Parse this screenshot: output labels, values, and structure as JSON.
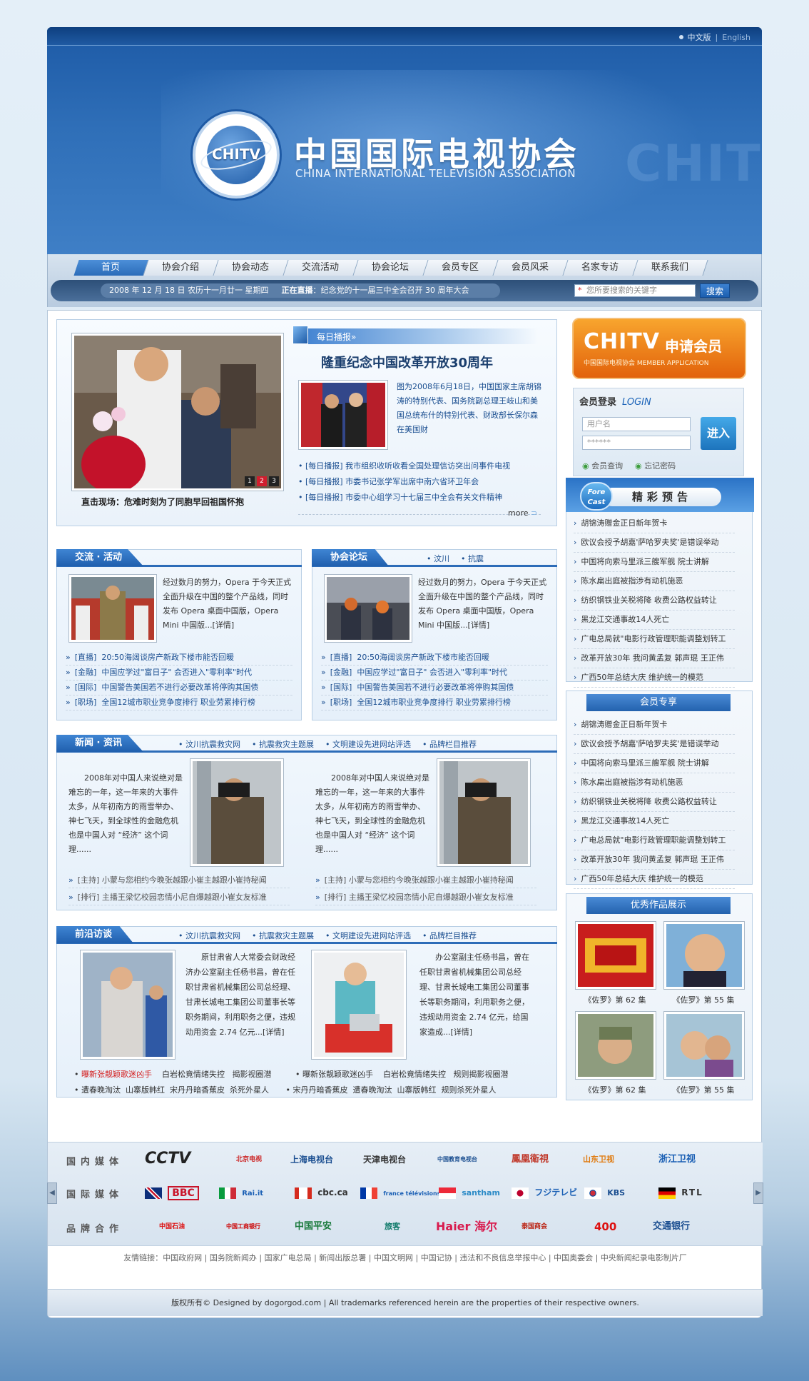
{
  "lang": {
    "cn": "中文版",
    "sep": "|",
    "en": "English"
  },
  "header": {
    "logo_text": "CHITV",
    "title_cn": "中国国际电视协会",
    "title_en": "CHINA INTERNATIONAL TELEVISION ASSOCIATION"
  },
  "nav": [
    "首页",
    "协会介绍",
    "协会动态",
    "交流活动",
    "协会论坛",
    "会员专区",
    "会员风采",
    "名家专访",
    "联系我们"
  ],
  "datebar": {
    "date": "2008 年 12 月 18 日   农历十一月廿一   星期四",
    "live_label": "正在直播",
    "live_text": "：纪念党的十一届三中全会召开 30 周年大会"
  },
  "search": {
    "placeholder": "您所要搜索的关键字",
    "button": "搜索"
  },
  "featured": {
    "photo_caption": "直击现场：危难时刻为了同胞早回祖国怀抱",
    "pager": [
      "1",
      "2",
      "3"
    ],
    "tab": "每日播报»",
    "headline": "隆重纪念中国改革开放30周年",
    "desc": "图为2008年6月18日，中国国家主席胡锦涛的特别代表、国务院副总理王岐山和美国总统布什的特别代表、财政部长保尔森在美国财",
    "links": [
      "[每日播报] 我市组织收听收看全国处理信访突出问事件电视",
      "[每日播报] 市委书记张学军出席中南六省环卫年会",
      "[每日播报] 市委中心组学习十七届三中全会有关文件精神"
    ],
    "more": "more"
  },
  "activities": {
    "title": "交流 · 活动",
    "text": "经过数月的努力，Opera 于今天正式全面升级在中国的整个产品线，同时发布 Opera 桌面中国版，Opera Mini 中国版...[详情]",
    "items": [
      {
        "tag": "[直播]",
        "text": "20:50海阔谈房产新政下楼市能否回暖"
      },
      {
        "tag": "[金融]",
        "text": "中国应学过\"富日子\" 会否进入\"零利率\"时代"
      },
      {
        "tag": "[国际]",
        "text": "中国警告美国若不进行必要改革将停购其国债"
      },
      {
        "tag": "[职场]",
        "text": "全国12城市职业竞争度排行 职业劳累排行榜"
      }
    ]
  },
  "forum": {
    "title": "协会论坛",
    "links": [
      "汶川",
      "抗震"
    ],
    "text": "经过数月的努力，Opera 于今天正式全面升级在中国的整个产品线，同时发布 Opera 桌面中国版，Opera Mini 中国版...[详情]",
    "items": [
      {
        "tag": "[直播]",
        "text": "20:50海阔谈房产新政下楼市能否回暖"
      },
      {
        "tag": "[金融]",
        "text": "中国应学过\"富日子\" 会否进入\"零利率\"时代"
      },
      {
        "tag": "[国际]",
        "text": "中国警告美国若不进行必要改革将停购其国债"
      },
      {
        "tag": "[职场]",
        "text": "全国12城市职业竞争度排行 职业劳累排行榜"
      }
    ]
  },
  "news": {
    "title": "新闻 · 资讯",
    "links": [
      "汶川抗震救灾网",
      "抗震救灾主题展",
      "文明建设先进网站评选",
      "品牌栏目推荐"
    ],
    "text": "2008年对中国人来说绝对是难忘的一年，这一年来的大事件太多，从年初南方的雨雪举办、神七飞天，到全球性的金融危机也是中国人对 “经济” 这个词理......",
    "items": [
      "[主持] 小蒙与您相约今晚张越跟小崔主越跟小崔持秘闻",
      "[排行] 主播王梁忆校园恋情小尼自爆越跟小崔女友标准"
    ]
  },
  "frontier": {
    "title": "前沿访谈",
    "links": [
      "汶川抗震救灾网",
      "抗震救灾主题展",
      "文明建设先进网站评选",
      "品牌栏目推荐"
    ],
    "text1": "原甘肃省人大常委会财政经济办公室副主任杨书昌，曾在任职甘肃省机械集团公司总经理、甘肃长城电工集团公司董事长等职务期间，利用职务之便，违规动用资金 2.74 亿元...[详情]",
    "text2": "办公室副主任杨书昌，曾在任职甘肃省机械集团公司总经理、甘肃长城电工集团公司董事长等职务期间，利用职务之便，违规动用资金 2.74 亿元，给国家造成...[详情]",
    "hot": [
      "曝新张靓颖歌迷凶手",
      "白岩松竟情绪失控",
      "揭影视圈潜",
      "曝新张靓颖歌迷凶手",
      "白岩松竟情绪失控",
      "规则揭影视圈潜"
    ],
    "hot2": [
      "遭春晚淘汰",
      "山寨版韩红",
      "宋丹丹暗香蕉皮",
      "杀死外星人",
      "宋丹丹暗香蕉皮",
      "遭春晚淘汰",
      "山寨版韩红",
      "规则杀死外星人"
    ]
  },
  "member_banner": {
    "big": "CHITV",
    "cn": "申请会员",
    "sub": "中国国际电视协会 MEMBER APPLICATION"
  },
  "login": {
    "title": "会员登录",
    "title_en": "LOGIN",
    "user_placeholder": "用户名",
    "pass_placeholder": "******",
    "button": "进入",
    "opt1": "会员查询",
    "opt2": "忘记密码"
  },
  "forecast": {
    "badge": "Fore Cast",
    "title": "精彩预告",
    "items": [
      "胡锦涛赠金正日新年贺卡",
      "欧议会授予胡嘉'萨哈罗夫奖'是错误举动",
      "中国将向索马里派三艘军舰 院士讲解",
      "陈水扁出庭被指涉有动机施恶",
      "纺织钢铁业关税将降 收费公路权益转让",
      "黑龙江交通事故14人死亡",
      "广电总局就\"电影行政管理职能调整划转工",
      "改革开放30年 我问黄孟复 郭声琨 王正伟",
      "广西50年总结大庆 维护统一的模范"
    ]
  },
  "member_zone": {
    "title": "会员专享",
    "items": [
      "胡锦涛赠金正日新年贺卡",
      "欧议会授予胡嘉'萨哈罗夫奖'是错误举动",
      "中国将向索马里派三艘军舰 院士讲解",
      "陈水扁出庭被指涉有动机施恶",
      "纺织钢铁业关税将降 收费公路权益转让",
      "黑龙江交通事故14人死亡",
      "广电总局就\"电影行政管理职能调整划转工",
      "改革开放30年 我问黄孟复 郭声琨 王正伟",
      "广西50年总结大庆 维护统一的模范"
    ]
  },
  "works": {
    "title": "优秀作品展示",
    "captions": [
      "《佐罗》第 62 集",
      "《佐罗》第 55 集",
      "《佐罗》第 62 集",
      "《佐罗》第 55 集"
    ]
  },
  "media": {
    "rows": [
      {
        "label": "国内媒体",
        "logos": [
          "CCTV",
          "北京电视",
          "上海电视台",
          "天津电视台",
          "中国教育电视台",
          "鳳凰衛視",
          "山东卫视",
          "浙江卫视"
        ]
      },
      {
        "label": "国际媒体",
        "logos": [
          "BBC",
          "Rai.it",
          "cbc.ca",
          "france télévisions",
          "santham",
          "フジテレビ",
          "KBS",
          "RTL"
        ]
      },
      {
        "label": "品牌合作",
        "logos": [
          "中国石油",
          "中国工商银行",
          "中国平安",
          "旅客",
          "Haier 海尔",
          "泰国商会",
          "400",
          "交通银行"
        ]
      }
    ],
    "left_arrow": "◀",
    "right_arrow": "▶"
  },
  "friends": {
    "label": "友情链接：",
    "links": [
      "中国政府网",
      "国务院新闻办",
      "国家广电总局",
      "新闻出版总署",
      "中国文明网",
      "中国记协",
      "违法和不良信息举报中心",
      "中国奥委会",
      "中央新闻纪录电影制片厂"
    ]
  },
  "footer": "版权所有© Designed by dogorgod.com  |  All trademarks referenced herein are the properties of their respective owners.",
  "colors": {
    "brand": "#1d5aa6",
    "accent": "#f08a1e",
    "link": "#1a4e90",
    "hot": "#d31b1b"
  }
}
